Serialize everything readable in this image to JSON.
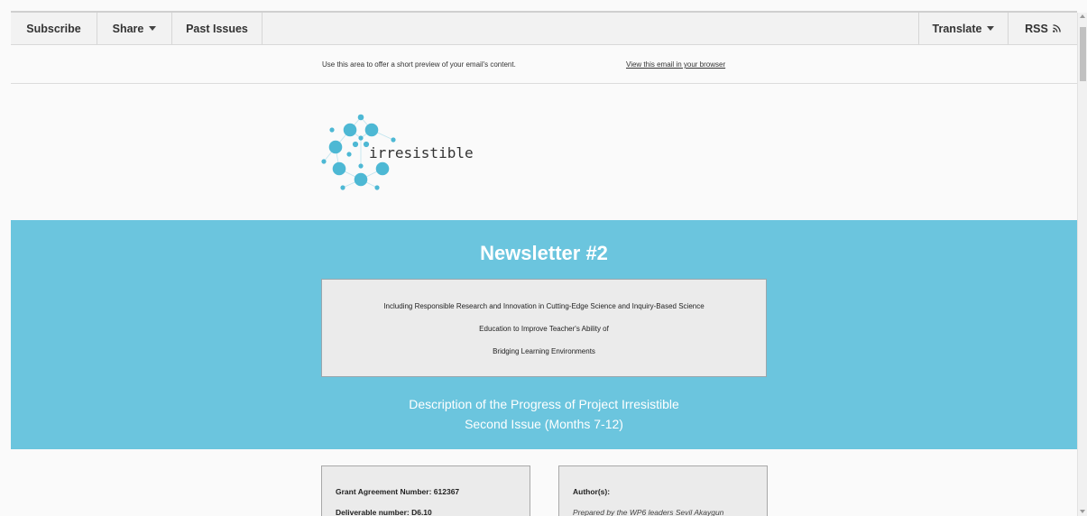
{
  "navbar": {
    "subscribe": "Subscribe",
    "share": "Share",
    "past_issues": "Past Issues",
    "translate": "Translate",
    "rss": "RSS"
  },
  "preview": {
    "text": "Use this area to offer a short preview of your email's content.",
    "view_link": "View this email in your browser"
  },
  "logo": {
    "text": "irresistible",
    "color": "#4db8d4"
  },
  "hero": {
    "title": "Newsletter #2",
    "box_lines": [
      "Including Responsible Research and Innovation in Cutting-Edge Science and Inquiry-Based Science",
      "Education to Improve Teacher's Ability of",
      "Bridging Learning Environments"
    ],
    "desc_line1": "Description of the Progress of Project Irresistible",
    "desc_line2": "Second Issue (Months 7-12)",
    "bg_color": "#6bc5de"
  },
  "cards": {
    "left": {
      "line1": "Grant Agreement Number: 612367",
      "line2": "Deliverable number: D6.10"
    },
    "right": {
      "line1": "Author(s):",
      "line2": "Prepared by the WP6 leaders Sevil Akaygun"
    }
  }
}
